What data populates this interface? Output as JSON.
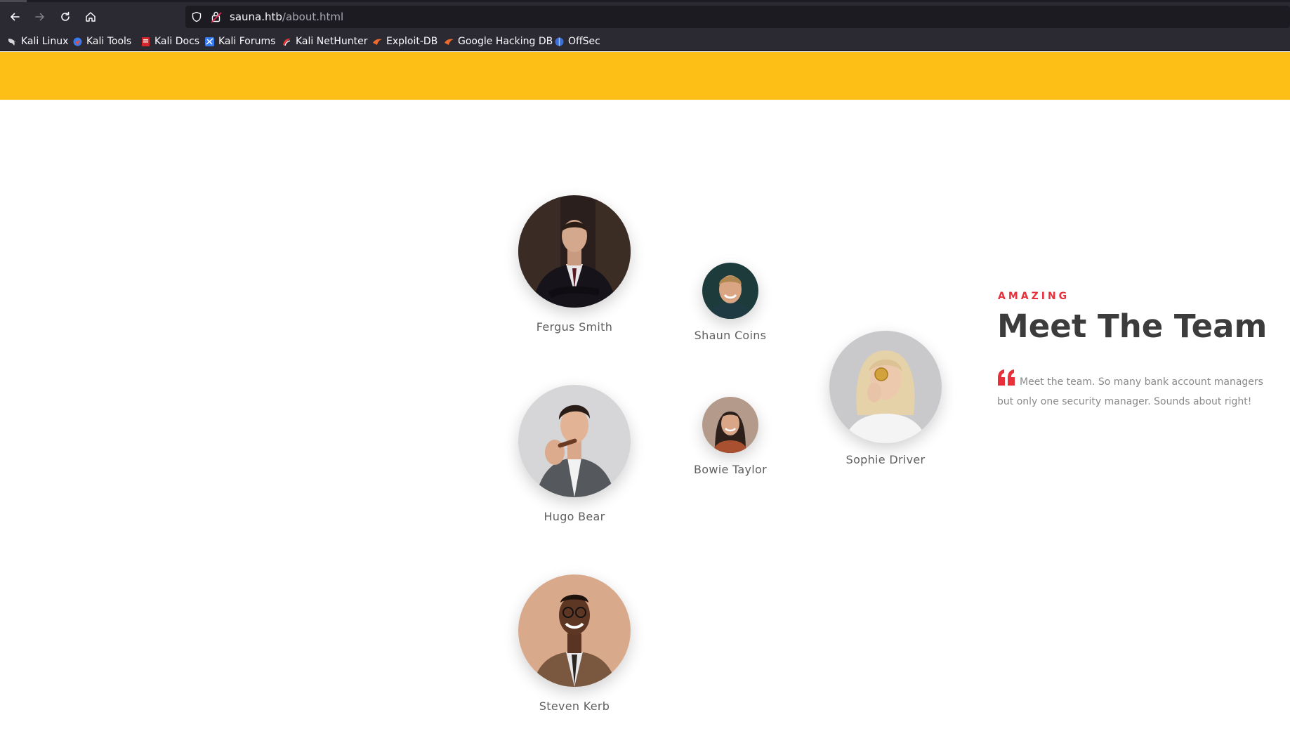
{
  "browser": {
    "url_domain": "sauna.htb",
    "url_path": "/about.html",
    "nav_icons": [
      "back-arrow-icon",
      "forward-arrow-icon",
      "reload-icon",
      "home-icon"
    ],
    "security_icons": [
      "shield-icon",
      "lock-warning-icon"
    ],
    "bookmarks": [
      {
        "label": "Kali Linux",
        "icon": "kali-dragon-icon"
      },
      {
        "label": "Kali Tools",
        "icon": "kali-tools-icon"
      },
      {
        "label": "Kali Docs",
        "icon": "kali-docs-icon"
      },
      {
        "label": "Kali Forums",
        "icon": "kali-forums-icon"
      },
      {
        "label": "Kali NetHunter",
        "icon": "nethunter-icon"
      },
      {
        "label": "Exploit-DB",
        "icon": "exploit-db-icon"
      },
      {
        "label": "Google Hacking DB",
        "icon": "ghdb-icon"
      },
      {
        "label": "OffSec",
        "icon": "offsec-icon"
      }
    ]
  },
  "colors": {
    "banner": "#fdbe15",
    "accent_red": "#e8303a",
    "heading": "#3c3c3c",
    "body_text": "#8a8a8a"
  },
  "team": {
    "members": [
      {
        "name": "Fergus Smith"
      },
      {
        "name": "Shaun Coins"
      },
      {
        "name": "Hugo Bear"
      },
      {
        "name": "Bowie Taylor"
      },
      {
        "name": "Sophie Driver"
      },
      {
        "name": "Steven Kerb"
      }
    ],
    "eyebrow": "AMAZING",
    "heading": "Meet The Team",
    "quote": "Meet the team. So many bank account managers but only one security manager. Sounds about right!"
  }
}
